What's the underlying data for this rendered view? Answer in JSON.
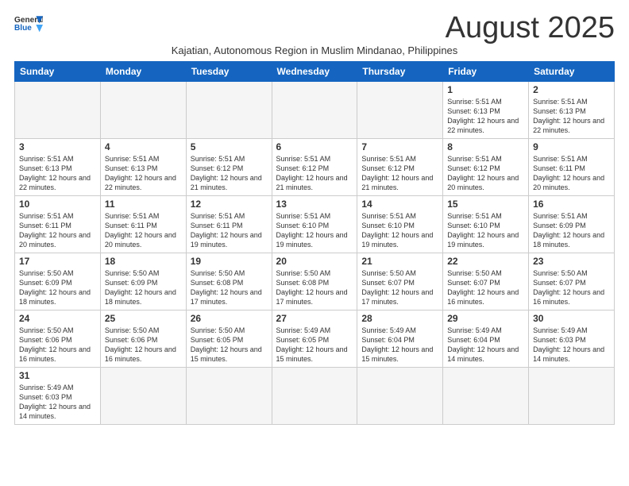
{
  "logo": {
    "line1": "General",
    "line2": "Blue"
  },
  "title": "August 2025",
  "subtitle": "Kajatian, Autonomous Region in Muslim Mindanao, Philippines",
  "weekdays": [
    "Sunday",
    "Monday",
    "Tuesday",
    "Wednesday",
    "Thursday",
    "Friday",
    "Saturday"
  ],
  "weeks": [
    [
      {
        "day": "",
        "info": ""
      },
      {
        "day": "",
        "info": ""
      },
      {
        "day": "",
        "info": ""
      },
      {
        "day": "",
        "info": ""
      },
      {
        "day": "",
        "info": ""
      },
      {
        "day": "1",
        "info": "Sunrise: 5:51 AM\nSunset: 6:13 PM\nDaylight: 12 hours\nand 22 minutes."
      },
      {
        "day": "2",
        "info": "Sunrise: 5:51 AM\nSunset: 6:13 PM\nDaylight: 12 hours\nand 22 minutes."
      }
    ],
    [
      {
        "day": "3",
        "info": "Sunrise: 5:51 AM\nSunset: 6:13 PM\nDaylight: 12 hours\nand 22 minutes."
      },
      {
        "day": "4",
        "info": "Sunrise: 5:51 AM\nSunset: 6:13 PM\nDaylight: 12 hours\nand 22 minutes."
      },
      {
        "day": "5",
        "info": "Sunrise: 5:51 AM\nSunset: 6:12 PM\nDaylight: 12 hours\nand 21 minutes."
      },
      {
        "day": "6",
        "info": "Sunrise: 5:51 AM\nSunset: 6:12 PM\nDaylight: 12 hours\nand 21 minutes."
      },
      {
        "day": "7",
        "info": "Sunrise: 5:51 AM\nSunset: 6:12 PM\nDaylight: 12 hours\nand 21 minutes."
      },
      {
        "day": "8",
        "info": "Sunrise: 5:51 AM\nSunset: 6:12 PM\nDaylight: 12 hours\nand 20 minutes."
      },
      {
        "day": "9",
        "info": "Sunrise: 5:51 AM\nSunset: 6:11 PM\nDaylight: 12 hours\nand 20 minutes."
      }
    ],
    [
      {
        "day": "10",
        "info": "Sunrise: 5:51 AM\nSunset: 6:11 PM\nDaylight: 12 hours\nand 20 minutes."
      },
      {
        "day": "11",
        "info": "Sunrise: 5:51 AM\nSunset: 6:11 PM\nDaylight: 12 hours\nand 20 minutes."
      },
      {
        "day": "12",
        "info": "Sunrise: 5:51 AM\nSunset: 6:11 PM\nDaylight: 12 hours\nand 19 minutes."
      },
      {
        "day": "13",
        "info": "Sunrise: 5:51 AM\nSunset: 6:10 PM\nDaylight: 12 hours\nand 19 minutes."
      },
      {
        "day": "14",
        "info": "Sunrise: 5:51 AM\nSunset: 6:10 PM\nDaylight: 12 hours\nand 19 minutes."
      },
      {
        "day": "15",
        "info": "Sunrise: 5:51 AM\nSunset: 6:10 PM\nDaylight: 12 hours\nand 19 minutes."
      },
      {
        "day": "16",
        "info": "Sunrise: 5:51 AM\nSunset: 6:09 PM\nDaylight: 12 hours\nand 18 minutes."
      }
    ],
    [
      {
        "day": "17",
        "info": "Sunrise: 5:50 AM\nSunset: 6:09 PM\nDaylight: 12 hours\nand 18 minutes."
      },
      {
        "day": "18",
        "info": "Sunrise: 5:50 AM\nSunset: 6:09 PM\nDaylight: 12 hours\nand 18 minutes."
      },
      {
        "day": "19",
        "info": "Sunrise: 5:50 AM\nSunset: 6:08 PM\nDaylight: 12 hours\nand 17 minutes."
      },
      {
        "day": "20",
        "info": "Sunrise: 5:50 AM\nSunset: 6:08 PM\nDaylight: 12 hours\nand 17 minutes."
      },
      {
        "day": "21",
        "info": "Sunrise: 5:50 AM\nSunset: 6:07 PM\nDaylight: 12 hours\nand 17 minutes."
      },
      {
        "day": "22",
        "info": "Sunrise: 5:50 AM\nSunset: 6:07 PM\nDaylight: 12 hours\nand 16 minutes."
      },
      {
        "day": "23",
        "info": "Sunrise: 5:50 AM\nSunset: 6:07 PM\nDaylight: 12 hours\nand 16 minutes."
      }
    ],
    [
      {
        "day": "24",
        "info": "Sunrise: 5:50 AM\nSunset: 6:06 PM\nDaylight: 12 hours\nand 16 minutes."
      },
      {
        "day": "25",
        "info": "Sunrise: 5:50 AM\nSunset: 6:06 PM\nDaylight: 12 hours\nand 16 minutes."
      },
      {
        "day": "26",
        "info": "Sunrise: 5:50 AM\nSunset: 6:05 PM\nDaylight: 12 hours\nand 15 minutes."
      },
      {
        "day": "27",
        "info": "Sunrise: 5:49 AM\nSunset: 6:05 PM\nDaylight: 12 hours\nand 15 minutes."
      },
      {
        "day": "28",
        "info": "Sunrise: 5:49 AM\nSunset: 6:04 PM\nDaylight: 12 hours\nand 15 minutes."
      },
      {
        "day": "29",
        "info": "Sunrise: 5:49 AM\nSunset: 6:04 PM\nDaylight: 12 hours\nand 14 minutes."
      },
      {
        "day": "30",
        "info": "Sunrise: 5:49 AM\nSunset: 6:03 PM\nDaylight: 12 hours\nand 14 minutes."
      }
    ],
    [
      {
        "day": "31",
        "info": "Sunrise: 5:49 AM\nSunset: 6:03 PM\nDaylight: 12 hours\nand 14 minutes."
      },
      {
        "day": "",
        "info": ""
      },
      {
        "day": "",
        "info": ""
      },
      {
        "day": "",
        "info": ""
      },
      {
        "day": "",
        "info": ""
      },
      {
        "day": "",
        "info": ""
      },
      {
        "day": "",
        "info": ""
      }
    ]
  ]
}
